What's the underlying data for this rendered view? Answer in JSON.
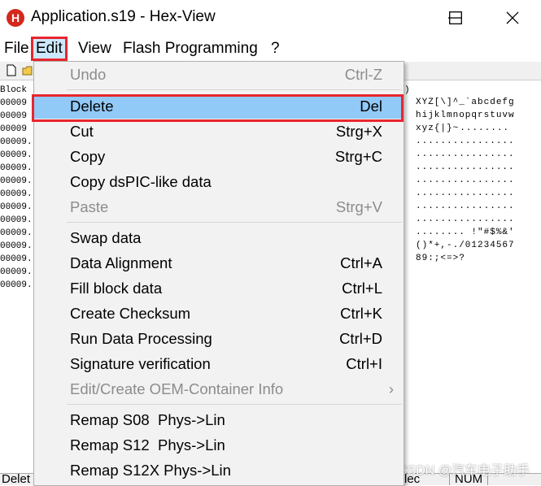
{
  "window": {
    "app_icon_letter": "H",
    "title": "Application.s19 - Hex-View",
    "min_icon": "minimize-icon",
    "max_icon": "maximize-icon",
    "close_icon": "close-icon"
  },
  "menubar": {
    "items": [
      "File",
      "Edit",
      "View",
      "Flash Programming",
      "?"
    ],
    "active": "Edit"
  },
  "hexview": {
    "column_header": "Block",
    "header_right": ")",
    "addresses": [
      "00009",
      "00009",
      "00009",
      "00009.",
      "00009.",
      "00009.",
      "00009.",
      "00009.",
      "00009.",
      "00009.",
      "00009.",
      "00009.",
      "00009.",
      "00009.",
      "00009."
    ],
    "ascii_lines": [
      "XYZ[\\]^_`abcdefg",
      "hijklmnopqrstuvw",
      "xyz{|}~........",
      "................",
      "................",
      "................",
      "................",
      "................",
      "................",
      "................",
      "........ !\"#$%&'",
      "()*+,-./01234567",
      "89:;<=>?"
    ]
  },
  "edit_menu": {
    "items": [
      {
        "label": "Undo",
        "shortcut": "Ctrl-Z",
        "enabled": false
      },
      {
        "label": "Delete",
        "shortcut": "Del",
        "enabled": true,
        "highlighted": true
      },
      {
        "label": "Cut",
        "shortcut": "Strg+X",
        "enabled": true
      },
      {
        "label": "Copy",
        "shortcut": "Strg+C",
        "enabled": true
      },
      {
        "label": "Copy dsPIC-like data",
        "shortcut": "",
        "enabled": true
      },
      {
        "label": "Paste",
        "shortcut": "Strg+V",
        "enabled": false
      },
      {
        "label": "Swap data",
        "shortcut": "",
        "enabled": true
      },
      {
        "label": "Data Alignment",
        "shortcut": "Ctrl+A",
        "enabled": true
      },
      {
        "label": "Fill block data",
        "shortcut": "Ctrl+L",
        "enabled": true
      },
      {
        "label": "Create Checksum",
        "shortcut": "Ctrl+K",
        "enabled": true
      },
      {
        "label": "Run Data Processing",
        "shortcut": "Ctrl+D",
        "enabled": true
      },
      {
        "label": "Signature verification",
        "shortcut": "Ctrl+I",
        "enabled": true
      },
      {
        "label": "Edit/Create OEM-Container Info",
        "shortcut": "›",
        "enabled": false
      },
      {
        "label": "Remap S08  Phys->Lin",
        "shortcut": "",
        "enabled": true
      },
      {
        "label": "Remap S12  Phys->Lin",
        "shortcut": "",
        "enabled": true
      },
      {
        "label": "Remap S12X Phys->Lin",
        "shortcut": "",
        "enabled": true
      }
    ]
  },
  "statusbar": {
    "left": "Delet",
    "mid": "lec",
    "right": "NUM"
  },
  "watermark": "CSDN @汽车电子助手",
  "colors": {
    "highlight": "#91c9f7",
    "annotation": "#e8262d",
    "menu_bg": "#f2f2f2",
    "disabled_text": "#8c8c8c"
  }
}
